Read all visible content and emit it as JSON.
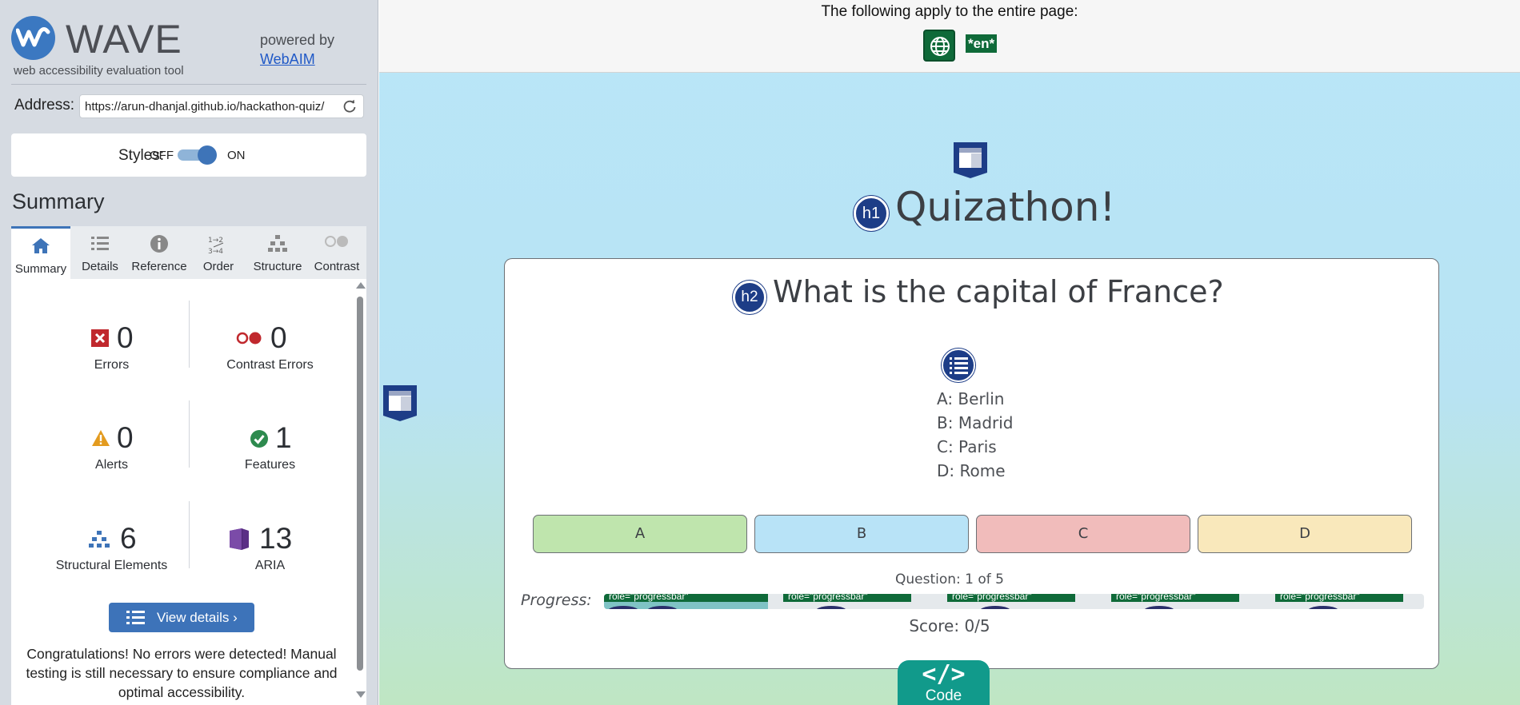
{
  "wave": {
    "logo_text": "WAVE",
    "tagline": "web accessibility evaluation tool",
    "powered_by": "powered by",
    "webaim_link": "WebAIM",
    "address_label": "Address:",
    "address_value": "https://arun-dhanjal.github.io/hackathon-quiz/",
    "styles_label": "Styles:",
    "styles_off": "OFF",
    "styles_on": "ON",
    "summary_heading": "Summary",
    "tabs": [
      {
        "label": "Summary",
        "icon": "home-icon"
      },
      {
        "label": "Details",
        "icon": "list-icon"
      },
      {
        "label": "Reference",
        "icon": "info-icon"
      },
      {
        "label": "Order",
        "icon": "order-icon"
      },
      {
        "label": "Structure",
        "icon": "structure-icon"
      },
      {
        "label": "Contrast",
        "icon": "contrast-icon"
      }
    ],
    "stats": {
      "errors": {
        "value": "0",
        "label": "Errors"
      },
      "contrast_errors": {
        "value": "0",
        "label": "Contrast Errors"
      },
      "alerts": {
        "value": "0",
        "label": "Alerts"
      },
      "features": {
        "value": "1",
        "label": "Features"
      },
      "structural": {
        "value": "6",
        "label": "Structural Elements"
      },
      "aria": {
        "value": "13",
        "label": "ARIA"
      }
    },
    "view_details": "View details ›",
    "congrats": "Congratulations! No errors were detected! Manual testing is still necessary to ensure compliance and optimal accessibility."
  },
  "page": {
    "banner_text": "The following apply to the entire page:",
    "lang_badge": "*en*",
    "h1_badge": "h1",
    "title": "Quizathon!",
    "h2_badge": "h2",
    "question": "What is the capital of France?",
    "options": [
      "A: Berlin",
      "B: Madrid",
      "C: Paris",
      "D: Rome"
    ],
    "answers": [
      {
        "label": "A",
        "color": "#bfe5ad"
      },
      {
        "label": "B",
        "color": "#b8e3f7"
      },
      {
        "label": "C",
        "color": "#f1bcbb"
      },
      {
        "label": "D",
        "color": "#f9e8bb"
      }
    ],
    "question_count": "Question: 1 of 5",
    "progress_label": "Progress:",
    "progress_fraction": 0.2,
    "progress_tag": "role=\"progressbar\"",
    "score": "Score: 0/5",
    "code_glyph": "</>",
    "code_label": "Code"
  },
  "colors": {
    "wave_blue": "#3e74b8",
    "error_red": "#c0282d",
    "alert_orange": "#e39b1f",
    "feature_green": "#2d8a4e",
    "structure_blue": "#3e74b8",
    "aria_purple": "#5b2f86",
    "badge_navy": "#1d3d87",
    "lang_green": "#0f6a39",
    "code_teal": "#119a8b"
  }
}
